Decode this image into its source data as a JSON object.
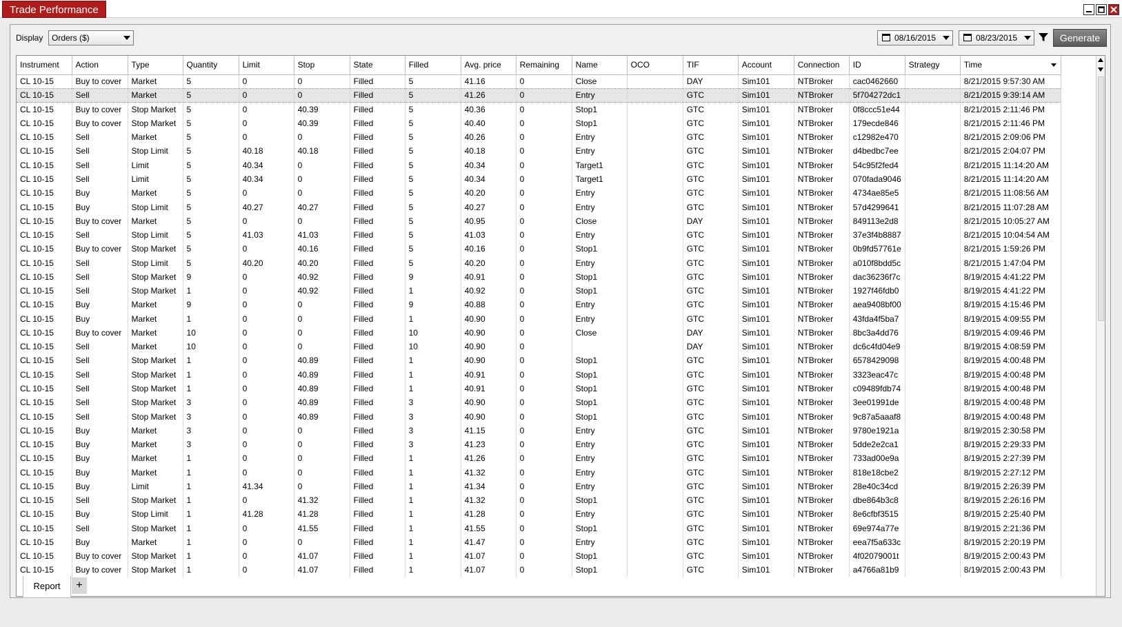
{
  "window": {
    "title": "Trade Performance"
  },
  "toolbar": {
    "display_label": "Display",
    "display_value": "Orders ($)",
    "start_date": "08/16/2015",
    "end_date": "08/23/2015",
    "generate_label": "Generate"
  },
  "grid": {
    "columns": [
      "Instrument",
      "Action",
      "Type",
      "Quantity",
      "Limit",
      "Stop",
      "State",
      "Filled",
      "Avg. price",
      "Remaining",
      "Name",
      "OCO",
      "TIF",
      "Account",
      "Connection",
      "ID",
      "Strategy",
      "Time"
    ],
    "rows": [
      [
        "CL 10-15",
        "Buy to cover",
        "Market",
        "5",
        "0",
        "0",
        "Filled",
        "5",
        "41.16",
        "0",
        "Close",
        "",
        "DAY",
        "Sim101",
        "NTBroker",
        "cac0462660",
        "",
        "8/21/2015 9:57:30 AM"
      ],
      [
        "CL 10-15",
        "Sell",
        "Market",
        "5",
        "0",
        "0",
        "Filled",
        "5",
        "41.26",
        "0",
        "Entry",
        "",
        "GTC",
        "Sim101",
        "NTBroker",
        "5f704272dc1",
        "",
        "8/21/2015 9:39:14 AM"
      ],
      [
        "CL 10-15",
        "Buy to cover",
        "Stop Market",
        "5",
        "0",
        "40.39",
        "Filled",
        "5",
        "40.36",
        "0",
        "Stop1",
        "",
        "GTC",
        "Sim101",
        "NTBroker",
        "0f8ccc51e44",
        "",
        "8/21/2015 2:11:46 PM"
      ],
      [
        "CL 10-15",
        "Buy to cover",
        "Stop Market",
        "5",
        "0",
        "40.39",
        "Filled",
        "5",
        "40.40",
        "0",
        "Stop1",
        "",
        "GTC",
        "Sim101",
        "NTBroker",
        "179ecde846",
        "",
        "8/21/2015 2:11:46 PM"
      ],
      [
        "CL 10-15",
        "Sell",
        "Market",
        "5",
        "0",
        "0",
        "Filled",
        "5",
        "40.26",
        "0",
        "Entry",
        "",
        "GTC",
        "Sim101",
        "NTBroker",
        "c12982e470",
        "",
        "8/21/2015 2:09:06 PM"
      ],
      [
        "CL 10-15",
        "Sell",
        "Stop Limit",
        "5",
        "40.18",
        "40.18",
        "Filled",
        "5",
        "40.18",
        "0",
        "Entry",
        "",
        "GTC",
        "Sim101",
        "NTBroker",
        "d4bedbc7ee",
        "",
        "8/21/2015 2:04:07 PM"
      ],
      [
        "CL 10-15",
        "Sell",
        "Limit",
        "5",
        "40.34",
        "0",
        "Filled",
        "5",
        "40.34",
        "0",
        "Target1",
        "",
        "GTC",
        "Sim101",
        "NTBroker",
        "54c95f2fed4",
        "",
        "8/21/2015 11:14:20 AM"
      ],
      [
        "CL 10-15",
        "Sell",
        "Limit",
        "5",
        "40.34",
        "0",
        "Filled",
        "5",
        "40.34",
        "0",
        "Target1",
        "",
        "GTC",
        "Sim101",
        "NTBroker",
        "070fada9046",
        "",
        "8/21/2015 11:14:20 AM"
      ],
      [
        "CL 10-15",
        "Buy",
        "Market",
        "5",
        "0",
        "0",
        "Filled",
        "5",
        "40.20",
        "0",
        "Entry",
        "",
        "GTC",
        "Sim101",
        "NTBroker",
        "4734ae85e5",
        "",
        "8/21/2015 11:08:56 AM"
      ],
      [
        "CL 10-15",
        "Buy",
        "Stop Limit",
        "5",
        "40.27",
        "40.27",
        "Filled",
        "5",
        "40.27",
        "0",
        "Entry",
        "",
        "GTC",
        "Sim101",
        "NTBroker",
        "57d4299641",
        "",
        "8/21/2015 11:07:28 AM"
      ],
      [
        "CL 10-15",
        "Buy to cover",
        "Market",
        "5",
        "0",
        "0",
        "Filled",
        "5",
        "40.95",
        "0",
        "Close",
        "",
        "DAY",
        "Sim101",
        "NTBroker",
        "849113e2d8",
        "",
        "8/21/2015 10:05:27 AM"
      ],
      [
        "CL 10-15",
        "Sell",
        "Stop Limit",
        "5",
        "41.03",
        "41.03",
        "Filled",
        "5",
        "41.03",
        "0",
        "Entry",
        "",
        "GTC",
        "Sim101",
        "NTBroker",
        "37e3f4b8887",
        "",
        "8/21/2015 10:04:54 AM"
      ],
      [
        "CL 10-15",
        "Buy to cover",
        "Stop Market",
        "5",
        "0",
        "40.16",
        "Filled",
        "5",
        "40.16",
        "0",
        "Stop1",
        "",
        "GTC",
        "Sim101",
        "NTBroker",
        "0b9fd57761e",
        "",
        "8/21/2015 1:59:26 PM"
      ],
      [
        "CL 10-15",
        "Sell",
        "Stop Limit",
        "5",
        "40.20",
        "40.20",
        "Filled",
        "5",
        "40.20",
        "0",
        "Entry",
        "",
        "GTC",
        "Sim101",
        "NTBroker",
        "a010f8bdd5c",
        "",
        "8/21/2015 1:47:04 PM"
      ],
      [
        "CL 10-15",
        "Sell",
        "Stop Market",
        "9",
        "0",
        "40.92",
        "Filled",
        "9",
        "40.91",
        "0",
        "Stop1",
        "",
        "GTC",
        "Sim101",
        "NTBroker",
        "dac36236f7c",
        "",
        "8/19/2015 4:41:22 PM"
      ],
      [
        "CL 10-15",
        "Sell",
        "Stop Market",
        "1",
        "0",
        "40.92",
        "Filled",
        "1",
        "40.92",
        "0",
        "Stop1",
        "",
        "GTC",
        "Sim101",
        "NTBroker",
        "1927f46fdb0",
        "",
        "8/19/2015 4:41:22 PM"
      ],
      [
        "CL 10-15",
        "Buy",
        "Market",
        "9",
        "0",
        "0",
        "Filled",
        "9",
        "40.88",
        "0",
        "Entry",
        "",
        "GTC",
        "Sim101",
        "NTBroker",
        "aea9408bf00",
        "",
        "8/19/2015 4:15:46 PM"
      ],
      [
        "CL 10-15",
        "Buy",
        "Market",
        "1",
        "0",
        "0",
        "Filled",
        "1",
        "40.90",
        "0",
        "Entry",
        "",
        "GTC",
        "Sim101",
        "NTBroker",
        "43fda4f5ba7",
        "",
        "8/19/2015 4:09:55 PM"
      ],
      [
        "CL 10-15",
        "Buy to cover",
        "Market",
        "10",
        "0",
        "0",
        "Filled",
        "10",
        "40.90",
        "0",
        "Close",
        "",
        "DAY",
        "Sim101",
        "NTBroker",
        "8bc3a4dd76",
        "",
        "8/19/2015 4:09:46 PM"
      ],
      [
        "CL 10-15",
        "Sell",
        "Market",
        "10",
        "0",
        "0",
        "Filled",
        "10",
        "40.90",
        "0",
        "",
        "",
        "DAY",
        "Sim101",
        "NTBroker",
        "dc6c4fd04e9",
        "",
        "8/19/2015 4:08:59 PM"
      ],
      [
        "CL 10-15",
        "Sell",
        "Stop Market",
        "1",
        "0",
        "40.89",
        "Filled",
        "1",
        "40.90",
        "0",
        "Stop1",
        "",
        "GTC",
        "Sim101",
        "NTBroker",
        "6578429098",
        "",
        "8/19/2015 4:00:48 PM"
      ],
      [
        "CL 10-15",
        "Sell",
        "Stop Market",
        "1",
        "0",
        "40.89",
        "Filled",
        "1",
        "40.91",
        "0",
        "Stop1",
        "",
        "GTC",
        "Sim101",
        "NTBroker",
        "3323eac47c",
        "",
        "8/19/2015 4:00:48 PM"
      ],
      [
        "CL 10-15",
        "Sell",
        "Stop Market",
        "1",
        "0",
        "40.89",
        "Filled",
        "1",
        "40.91",
        "0",
        "Stop1",
        "",
        "GTC",
        "Sim101",
        "NTBroker",
        "c09489fdb74",
        "",
        "8/19/2015 4:00:48 PM"
      ],
      [
        "CL 10-15",
        "Sell",
        "Stop Market",
        "3",
        "0",
        "40.89",
        "Filled",
        "3",
        "40.90",
        "0",
        "Stop1",
        "",
        "GTC",
        "Sim101",
        "NTBroker",
        "3ee01991de",
        "",
        "8/19/2015 4:00:48 PM"
      ],
      [
        "CL 10-15",
        "Sell",
        "Stop Market",
        "3",
        "0",
        "40.89",
        "Filled",
        "3",
        "40.90",
        "0",
        "Stop1",
        "",
        "GTC",
        "Sim101",
        "NTBroker",
        "9c87a5aaaf8",
        "",
        "8/19/2015 4:00:48 PM"
      ],
      [
        "CL 10-15",
        "Buy",
        "Market",
        "3",
        "0",
        "0",
        "Filled",
        "3",
        "41.15",
        "0",
        "Entry",
        "",
        "GTC",
        "Sim101",
        "NTBroker",
        "9780e1921a",
        "",
        "8/19/2015 2:30:58 PM"
      ],
      [
        "CL 10-15",
        "Buy",
        "Market",
        "3",
        "0",
        "0",
        "Filled",
        "3",
        "41.23",
        "0",
        "Entry",
        "",
        "GTC",
        "Sim101",
        "NTBroker",
        "5dde2e2ca1",
        "",
        "8/19/2015 2:29:33 PM"
      ],
      [
        "CL 10-15",
        "Buy",
        "Market",
        "1",
        "0",
        "0",
        "Filled",
        "1",
        "41.26",
        "0",
        "Entry",
        "",
        "GTC",
        "Sim101",
        "NTBroker",
        "733ad00e9a",
        "",
        "8/19/2015 2:27:39 PM"
      ],
      [
        "CL 10-15",
        "Buy",
        "Market",
        "1",
        "0",
        "0",
        "Filled",
        "1",
        "41.32",
        "0",
        "Entry",
        "",
        "GTC",
        "Sim101",
        "NTBroker",
        "818e18cbe2",
        "",
        "8/19/2015 2:27:12 PM"
      ],
      [
        "CL 10-15",
        "Buy",
        "Limit",
        "1",
        "41.34",
        "0",
        "Filled",
        "1",
        "41.34",
        "0",
        "Entry",
        "",
        "GTC",
        "Sim101",
        "NTBroker",
        "28e40c34cd",
        "",
        "8/19/2015 2:26:39 PM"
      ],
      [
        "CL 10-15",
        "Sell",
        "Stop Market",
        "1",
        "0",
        "41.32",
        "Filled",
        "1",
        "41.32",
        "0",
        "Stop1",
        "",
        "GTC",
        "Sim101",
        "NTBroker",
        "dbe864b3c8",
        "",
        "8/19/2015 2:26:16 PM"
      ],
      [
        "CL 10-15",
        "Buy",
        "Stop Limit",
        "1",
        "41.28",
        "41.28",
        "Filled",
        "1",
        "41.28",
        "0",
        "Entry",
        "",
        "GTC",
        "Sim101",
        "NTBroker",
        "8e6cfbf3515",
        "",
        "8/19/2015 2:25:40 PM"
      ],
      [
        "CL 10-15",
        "Sell",
        "Stop Market",
        "1",
        "0",
        "41.55",
        "Filled",
        "1",
        "41.55",
        "0",
        "Stop1",
        "",
        "GTC",
        "Sim101",
        "NTBroker",
        "69e974a77e",
        "",
        "8/19/2015 2:21:36 PM"
      ],
      [
        "CL 10-15",
        "Buy",
        "Market",
        "1",
        "0",
        "0",
        "Filled",
        "1",
        "41.47",
        "0",
        "Entry",
        "",
        "GTC",
        "Sim101",
        "NTBroker",
        "eea7f5a633c",
        "",
        "8/19/2015 2:20:19 PM"
      ],
      [
        "CL 10-15",
        "Buy to cover",
        "Stop Market",
        "1",
        "0",
        "41.07",
        "Filled",
        "1",
        "41.07",
        "0",
        "Stop1",
        "",
        "GTC",
        "Sim101",
        "NTBroker",
        "4f02079001t",
        "",
        "8/19/2015 2:00:43 PM"
      ],
      [
        "CL 10-15",
        "Buy to cover",
        "Stop Market",
        "1",
        "0",
        "41.07",
        "Filled",
        "1",
        "41.07",
        "0",
        "Stop1",
        "",
        "GTC",
        "Sim101",
        "NTBroker",
        "a4766a81b9",
        "",
        "8/19/2015 2:00:43 PM"
      ]
    ]
  },
  "tabs": {
    "report": "Report",
    "add": "+"
  },
  "colors": {
    "title_bg": "#b01c1c",
    "generate_bg": "#6e6e6e",
    "selected_row": "#e6e6e6"
  }
}
